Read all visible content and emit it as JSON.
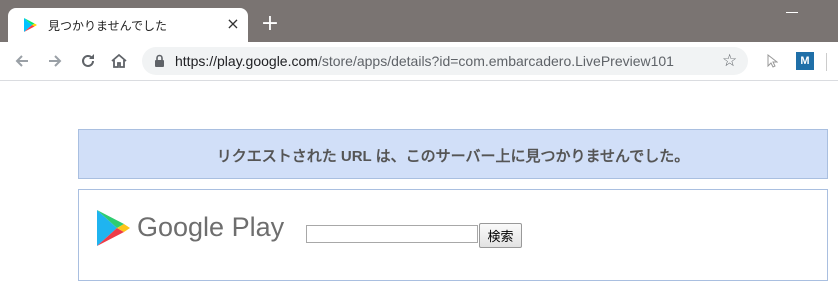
{
  "browser": {
    "tab_title": "見つかりませんでした",
    "tab_close": "×",
    "new_tab": "+",
    "url_host": "https://play.google.com",
    "url_path": "/store/apps/details?id=com.embarcadero.LivePreview101",
    "extension_label": "M"
  },
  "page": {
    "error_message": "リクエストされた URL は、このサーバー上に見つかりませんでした。",
    "logo_text": "Google Play",
    "search_value": "",
    "search_button": "検索"
  },
  "colors": {
    "titlebar": "#7a7472",
    "banner_bg": "#d1dff8",
    "banner_border": "#a9bfe0"
  }
}
